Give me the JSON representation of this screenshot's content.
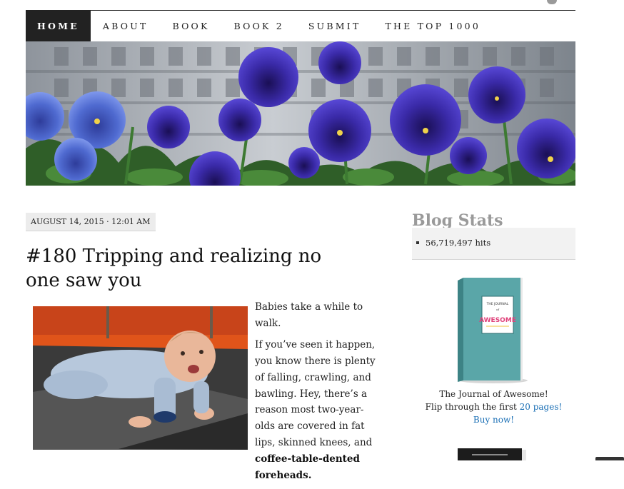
{
  "nav": {
    "items": [
      {
        "label": "HOME",
        "active": true
      },
      {
        "label": "ABOUT",
        "active": false
      },
      {
        "label": "BOOK",
        "active": false
      },
      {
        "label": "BOOK 2",
        "active": false
      },
      {
        "label": "SUBMIT",
        "active": false
      },
      {
        "label": "THE TOP 1000",
        "active": false
      }
    ]
  },
  "header_image": {
    "alt": "purple-pansies-header"
  },
  "post": {
    "date": "AUGUST 14, 2015 · 12:01 AM",
    "title": "#180 Tripping and realizing no one saw you",
    "photo": "crawling-baby-photo",
    "paragraph_1": "Babies take a while to walk.",
    "paragraph_2_text": "If you’ve seen it happen, you know there is plenty of falling, crawling, and bawling. Hey, there’s a reason most two-year-olds are covered in fat lips, skinned knees, and ",
    "paragraph_2_bold": "coffee-table-dented foreheads."
  },
  "sidebar": {
    "stats_title": "Blog Stats",
    "hits": "56,719,497 hits",
    "book": {
      "cover_title_line1": "THE JOURNAL",
      "cover_title_line2": "of",
      "cover_title_line3": "AWESOME",
      "caption_line1": "The Journal of Awesome!",
      "caption_line2_text": "Flip through the first ",
      "caption_line2_link": "20 pages!",
      "caption_line3_link": "Buy now!"
    }
  },
  "colors": {
    "nav_active_bg": "#222222",
    "link": "#1a6fb5",
    "sidebar_title": "#9a9a9a",
    "book_teal": "#5aa6a8"
  }
}
